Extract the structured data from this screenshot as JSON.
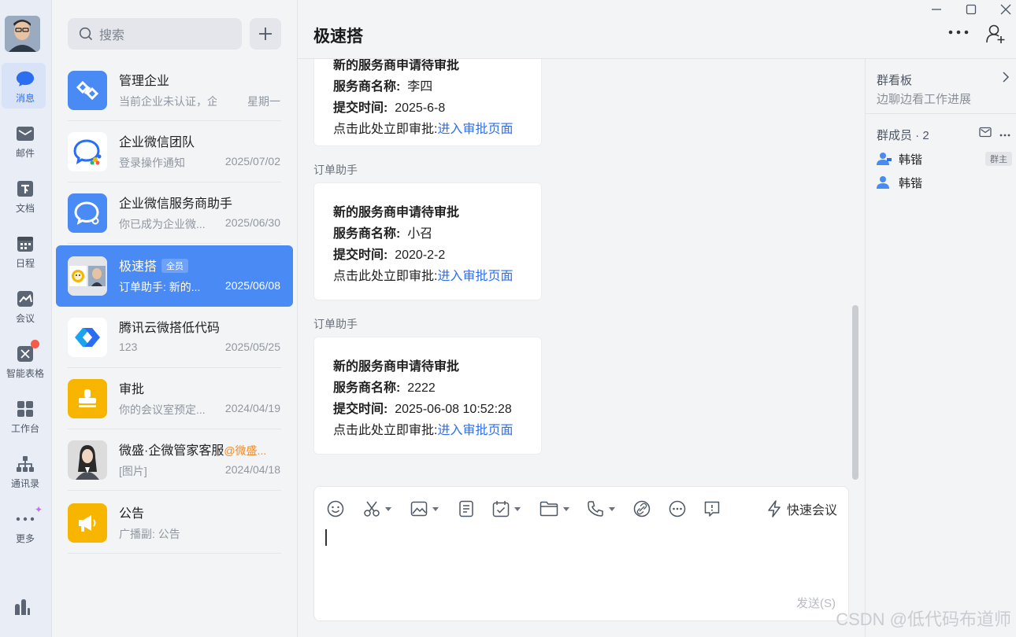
{
  "nav": {
    "items": [
      {
        "label": "消息",
        "icon": "chat-bubble-icon"
      },
      {
        "label": "邮件",
        "icon": "mail-icon"
      },
      {
        "label": "文档",
        "icon": "document-icon"
      },
      {
        "label": "日程",
        "icon": "calendar-icon"
      },
      {
        "label": "会议",
        "icon": "meeting-icon"
      },
      {
        "label": "智能表格",
        "icon": "smart-sheet-icon"
      },
      {
        "label": "工作台",
        "icon": "workbench-icon"
      },
      {
        "label": "通讯录",
        "icon": "contacts-icon"
      },
      {
        "label": "更多",
        "icon": "more-dots-icon"
      }
    ],
    "active": "消息"
  },
  "search": {
    "placeholder": "搜索"
  },
  "conversations": [
    {
      "name": "管理企业",
      "preview": "当前企业未认证，企...",
      "time": "星期一",
      "avatar_color": "#4a8af5"
    },
    {
      "name": "企业微信团队",
      "preview": "登录操作通知",
      "time": "2025/07/02",
      "avatar_color": "#ffffff"
    },
    {
      "name": "企业微信服务商助手",
      "preview": "你已成为企业微...",
      "time": "2025/06/30",
      "avatar_color": "#4a8af5"
    },
    {
      "name": "极速搭",
      "badge": "全员",
      "preview": "订单助手: 新的...",
      "time": "2025/06/08",
      "avatar_color": "#e3e5e9"
    },
    {
      "name": "腾讯云微搭低代码",
      "preview": "123",
      "time": "2025/05/25",
      "avatar_color": "#ffffff"
    },
    {
      "name": "审批",
      "preview": "你的会议室预定...",
      "time": "2024/04/19",
      "avatar_color": "#f7b500"
    },
    {
      "name": "微盛·企微管家客服",
      "mention": "@微盛...",
      "preview": "[图片]",
      "time": "2024/04/18",
      "avatar_color": "#d8d8d8"
    },
    {
      "name": "公告",
      "preview": "广播副: 公告",
      "time": "",
      "avatar_color": "#f7b500"
    }
  ],
  "chat": {
    "title": "极速搭",
    "messages": [
      {
        "sender": "",
        "title": "新的服务商申请待审批",
        "provider_label": "服务商名称:",
        "provider": "李四",
        "time_label": "提交时间:",
        "time": "2025-6-8",
        "action_label": "点击此处立即审批:",
        "action_link": "进入审批页面"
      },
      {
        "sender": "订单助手",
        "title": "新的服务商申请待审批",
        "provider_label": "服务商名称:",
        "provider": "小召",
        "time_label": "提交时间:",
        "time": "2020-2-2",
        "action_label": "点击此处立即审批:",
        "action_link": "进入审批页面"
      },
      {
        "sender": "订单助手",
        "title": "新的服务商申请待审批",
        "provider_label": "服务商名称:",
        "provider": "2222",
        "time_label": "提交时间:",
        "time": "2025-06-08 10:52:28",
        "action_label": "点击此处立即审批:",
        "action_link": "进入审批页面"
      }
    ],
    "composer": {
      "quick_meeting": "快速会议",
      "send": "发送(S)"
    }
  },
  "side": {
    "board_title": "群看板",
    "board_sub": "边聊边看工作进展",
    "members_title": "群成员 · 2",
    "members": [
      {
        "name": "韩锴",
        "role": "群主"
      },
      {
        "name": "韩锴",
        "role": ""
      }
    ]
  },
  "watermark": "CSDN @低代码布道师",
  "colors": {
    "accent": "#2b6ef2",
    "active_conversation": "#4a8af5",
    "badge_red": "#f35b4b"
  }
}
